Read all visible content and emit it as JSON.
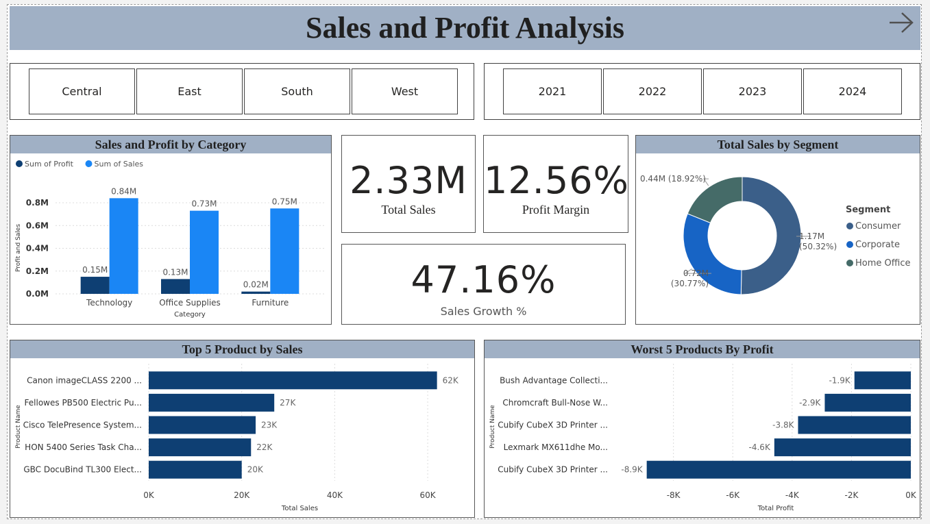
{
  "header": {
    "title": "Sales and Profit Analysis"
  },
  "region_slicer": {
    "items": [
      "Central",
      "East",
      "South",
      "West"
    ]
  },
  "year_slicer": {
    "items": [
      "2021",
      "2022",
      "2023",
      "2024"
    ]
  },
  "kpis": {
    "total_sales": {
      "value": "2.33M",
      "label": "Total Sales"
    },
    "profit_margin": {
      "value": "12.56%",
      "label": "Profit Margin"
    },
    "sales_growth": {
      "value": "47.16%",
      "label": "Sales Growth %"
    }
  },
  "colors": {
    "profit": "#0e3f73",
    "sales": "#1a86f5",
    "consumer": "#3b5f89",
    "corporate": "#1764c5",
    "home_office": "#456b68",
    "hbar": "#0e3f73"
  },
  "chart_data": [
    {
      "id": "category",
      "type": "bar",
      "title": "Sales and Profit by Category",
      "xlabel": "Category",
      "ylabel": "Profit and Sales",
      "categories": [
        "Technology",
        "Office Supplies",
        "Furniture"
      ],
      "series": [
        {
          "name": "Sum of Profit",
          "values": [
            0.15,
            0.13,
            0.02
          ],
          "labels": [
            "0.15M",
            "0.13M",
            "0.02M"
          ]
        },
        {
          "name": "Sum of Sales",
          "values": [
            0.84,
            0.73,
            0.75
          ],
          "labels": [
            "0.84M",
            "0.73M",
            "0.75M"
          ]
        }
      ],
      "ylim": [
        0,
        0.8
      ],
      "yticks": [
        "0.0M",
        "0.2M",
        "0.4M",
        "0.6M",
        "0.8M"
      ],
      "legend": "top-left",
      "grid": true
    },
    {
      "id": "segment",
      "type": "pie",
      "title": "Total Sales by Segment",
      "legend_title": "Segment",
      "legend": "right",
      "slices": [
        {
          "name": "Consumer",
          "value": 50.32,
          "label": "1.17M",
          "pct": "(50.32%)"
        },
        {
          "name": "Corporate",
          "value": 30.77,
          "label": "0.72M",
          "pct": "(30.77%)"
        },
        {
          "name": "Home Office",
          "value": 18.92,
          "label": "0.44M (18.92%)",
          "pct": ""
        }
      ]
    },
    {
      "id": "top5",
      "type": "bar",
      "orientation": "horizontal",
      "title": "Top 5 Product by Sales",
      "xlabel": "Total Sales",
      "ylabel": "Product Name",
      "categories": [
        "Canon imageCLASS 2200 ...",
        "Fellowes PB500 Electric Pu...",
        "Cisco TelePresence System...",
        "HON 5400 Series Task Cha...",
        "GBC DocuBind TL300 Elect..."
      ],
      "values": [
        62,
        27,
        23,
        22,
        20
      ],
      "labels": [
        "62K",
        "27K",
        "23K",
        "22K",
        "20K"
      ],
      "xlim": [
        0,
        65
      ],
      "xticks": [
        "0K",
        "20K",
        "40K",
        "60K"
      ],
      "grid": true
    },
    {
      "id": "worst5",
      "type": "bar",
      "orientation": "horizontal",
      "title": "Worst 5 Products By Profit",
      "xlabel": "Total Profit",
      "ylabel": "Product Name",
      "categories": [
        "Bush Advantage Collecti...",
        "Chromcraft Bull-Nose W...",
        "Cubify CubeX 3D Printer ...",
        "Lexmark MX611dhe Mo...",
        "Cubify CubeX 3D Printer ..."
      ],
      "values": [
        -1.9,
        -2.9,
        -3.8,
        -4.6,
        -8.9
      ],
      "labels": [
        "-1.9K",
        "-2.9K",
        "-3.8K",
        "-4.6K",
        "-8.9K"
      ],
      "xlim": [
        -9.1,
        0
      ],
      "xticks": [
        "-8K",
        "-6K",
        "-4K",
        "-2K",
        "0K"
      ],
      "grid": true
    }
  ]
}
